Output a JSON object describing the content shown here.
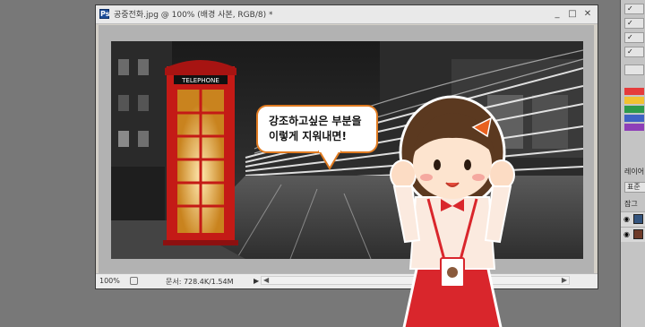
{
  "document": {
    "title": "공중전화.jpg @ 100% (배경 사본, RGB/8) *",
    "app_icon": "Ps",
    "window_buttons": [
      "_",
      "□",
      "✕"
    ],
    "zoom": "100%",
    "doc_size": "문서: 728.4K/1.54M",
    "status_arrow": "▶"
  },
  "photo": {
    "booth_sign": "TELEPHONE",
    "highlight_color": "#e8231e"
  },
  "speech_bubble": {
    "line1": "강조하고싶은 부분을",
    "line2": "이렇게 지워내면!"
  },
  "right_panel": {
    "tabs": [
      "레이어"
    ],
    "blend_mode": "표준",
    "lock_label": "잠그",
    "swatch_colors": [
      "#e53b3b",
      "#f1c232",
      "#2d9a4b",
      "#3f62c4",
      "#8e3fb8"
    ]
  },
  "icons": [
    "photoshop-app-icon",
    "minimize-icon",
    "maximize-icon",
    "close-icon",
    "eye-icon",
    "scroll-left-icon",
    "scroll-right-icon"
  ]
}
